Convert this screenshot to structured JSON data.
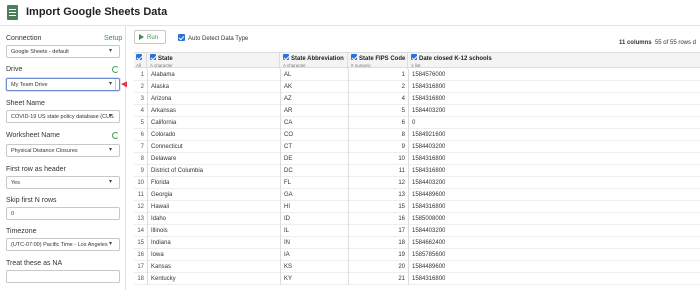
{
  "window": {
    "title": "Import Google Sheets Data"
  },
  "sidebar": {
    "connection_label": "Connection",
    "setup_link": "Setup",
    "connection_value": "Google Sheets - default",
    "drive_label": "Drive",
    "drive_value": "My Team Drive",
    "sheet_name_label": "Sheet Name",
    "sheet_name_value": "COVID-19 US state policy database (CUS",
    "worksheet_name_label": "Worksheet Name",
    "worksheet_name_value": "Physical Distance Closures",
    "first_row_label": "First row as header",
    "first_row_value": "Yes",
    "skip_rows_label": "Skip first N rows",
    "skip_rows_value": "0",
    "timezone_label": "Timezone",
    "timezone_value": "(UTC-07:00) Pacific Time - Los Angeles",
    "treat_na_label": "Treat these as NA",
    "treat_na_value": ""
  },
  "toolbar": {
    "run_label": "Run",
    "auto_detect_label": "Auto Detect Data Type",
    "columns_count": "11 columns",
    "rows_count": "55 of 55 rows d"
  },
  "table": {
    "all_label": "All",
    "columns": [
      {
        "name": "State",
        "type": "character"
      },
      {
        "name": "State Abbreviation",
        "type": "character"
      },
      {
        "name": "State FIPS Code",
        "type": "numeric"
      },
      {
        "name": "Date closed K-12 schools",
        "type": "list"
      }
    ],
    "rows": [
      [
        "1",
        "Alabama",
        "AL",
        "1",
        "1584576000"
      ],
      [
        "2",
        "Alaska",
        "AK",
        "2",
        "1584316800"
      ],
      [
        "3",
        "Arizona",
        "AZ",
        "4",
        "1584316800"
      ],
      [
        "4",
        "Arkansas",
        "AR",
        "5",
        "1584403200"
      ],
      [
        "5",
        "California",
        "CA",
        "6",
        "0"
      ],
      [
        "6",
        "Colorado",
        "CO",
        "8",
        "1584921600"
      ],
      [
        "7",
        "Connecticut",
        "CT",
        "9",
        "1584403200"
      ],
      [
        "8",
        "Delaware",
        "DE",
        "10",
        "1584316800"
      ],
      [
        "9",
        "District of Columbia",
        "DC",
        "11",
        "1584316800"
      ],
      [
        "10",
        "Florida",
        "FL",
        "12",
        "1584403200"
      ],
      [
        "11",
        "Georgia",
        "GA",
        "13",
        "1584489600"
      ],
      [
        "12",
        "Hawaii",
        "HI",
        "15",
        "1584316800"
      ],
      [
        "13",
        "Idaho",
        "ID",
        "16",
        "1585008000"
      ],
      [
        "14",
        "Illinois",
        "IL",
        "17",
        "1584403200"
      ],
      [
        "15",
        "Indiana",
        "IN",
        "18",
        "1584662400"
      ],
      [
        "16",
        "Iowa",
        "IA",
        "19",
        "1585785600"
      ],
      [
        "17",
        "Kansas",
        "KS",
        "20",
        "1584489600"
      ],
      [
        "18",
        "Kentucky",
        "KY",
        "21",
        "1584316800"
      ]
    ]
  },
  "colors": {
    "accent_green": "#3d8d4f",
    "checkbox_blue": "#2c72d6",
    "arrow_red": "#e8344a"
  }
}
